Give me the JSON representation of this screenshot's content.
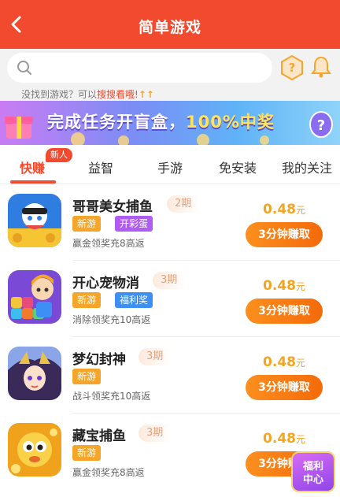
{
  "header": {
    "title": "简单游戏",
    "back_icon": "chevron-left-icon"
  },
  "search": {
    "placeholder": "",
    "hint_prefix": "没找到游戏？可以",
    "hint_link": "搜搜看哦!",
    "hint_arrows": "↑↑"
  },
  "banner": {
    "text_main": "完成任务开盲盒，",
    "text_highlight": "100%中奖"
  },
  "tabs": [
    {
      "label": "快赚",
      "active": true,
      "badge": "新人"
    },
    {
      "label": "益智"
    },
    {
      "label": "手游"
    },
    {
      "label": "免安装"
    },
    {
      "label": "我的关注"
    }
  ],
  "games": [
    {
      "name": "哥哥美女捕鱼",
      "period": "2期",
      "tags": [
        {
          "text": "新游",
          "color": "orange"
        },
        {
          "text": "开彩蛋",
          "color": "purple"
        }
      ],
      "desc": "赢金领奖充8高返",
      "price": "0.48",
      "unit": "元",
      "button": "3分钟赚取"
    },
    {
      "name": "开心宠物消",
      "period": "3期",
      "tags": [
        {
          "text": "新游",
          "color": "orange"
        },
        {
          "text": "福利奖",
          "color": "blue"
        }
      ],
      "desc": "消除领奖充10高返",
      "price": "0.48",
      "unit": "元",
      "button": "3分钟赚取"
    },
    {
      "name": "梦幻封神",
      "period": "3期",
      "tags": [
        {
          "text": "新游",
          "color": "orange"
        }
      ],
      "desc": "战斗领奖充10高返",
      "price": "0.48",
      "unit": "元",
      "button": "3分钟赚取"
    },
    {
      "name": "藏宝捕鱼",
      "period": "3期",
      "tags": [
        {
          "text": "新游",
          "color": "orange"
        }
      ],
      "desc": "赢金领奖充8高返",
      "price": "0.48",
      "unit": "元",
      "button": "3分钟赚取"
    }
  ],
  "floating": {
    "line1": "福利",
    "line2": "中心"
  },
  "colors": {
    "primary": "#f14a2e",
    "price": "#f5a41e",
    "button": "#f56a0a"
  }
}
